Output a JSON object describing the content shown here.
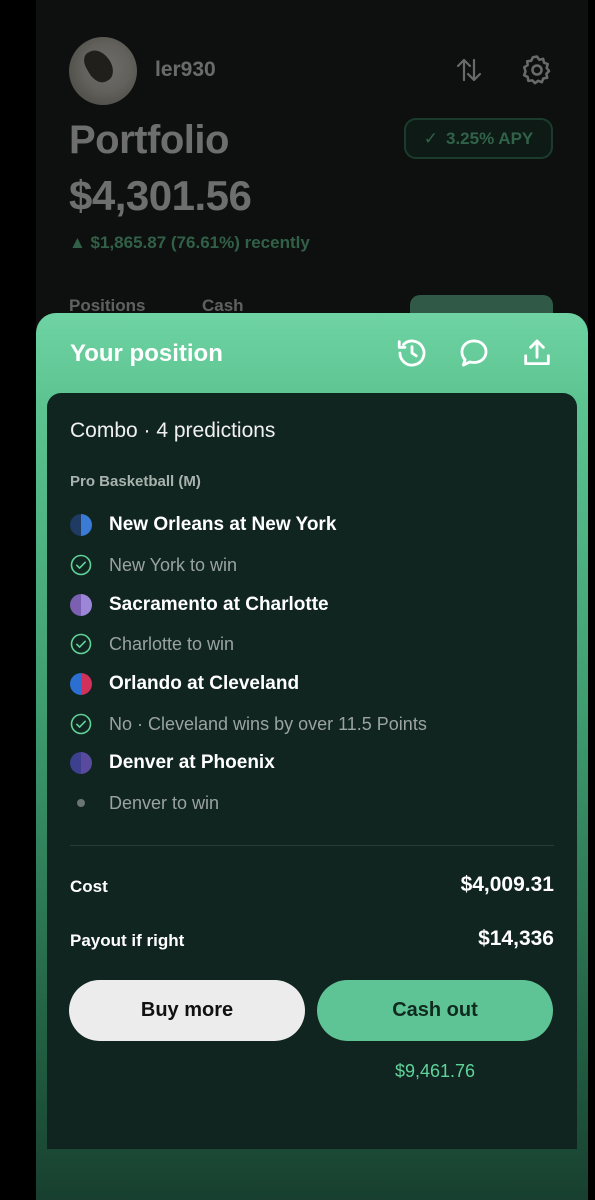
{
  "header": {
    "username": "ler930",
    "title": "Portfolio",
    "value": "$4,301.56",
    "change": "▲ $1,865.87 (76.61%) recently",
    "apy_check": "✓",
    "apy": "3.25% APY",
    "tabs": [
      "Positions",
      "Cash"
    ]
  },
  "sheet": {
    "title": "Your position",
    "combo_title": "Combo · 4 predictions",
    "league": "Pro Basketball (M)",
    "games": [
      {
        "name": "New Orleans at New York",
        "pick": "New York to win",
        "colors": [
          "#1f3a63",
          "#3a7bd5"
        ],
        "status": "check"
      },
      {
        "name": "Sacramento at Charlotte",
        "pick": "Charlotte to win",
        "colors": [
          "#7b5fb0",
          "#9d86d8"
        ],
        "status": "check"
      },
      {
        "name": "Orlando at Cleveland",
        "pick": "No · Cleveland wins by over 11.5 Points",
        "colors": [
          "#2b6fd0",
          "#d0305a"
        ],
        "status": "check"
      },
      {
        "name": "Denver at Phoenix",
        "pick": "Denver to win",
        "colors": [
          "#3d3f8f",
          "#5a4a9e"
        ],
        "status": "pending"
      }
    ],
    "cost_label": "Cost",
    "cost_value": "$4,009.31",
    "payout_label": "Payout if right",
    "payout_value": "$14,336",
    "buy_more_label": "Buy more",
    "cash_out_label": "Cash out",
    "cash_out_amount": "$9,461.76"
  },
  "colors": {
    "accent": "#5fc495",
    "accent_text": "#5fd39a",
    "card_bg": "#112520"
  }
}
